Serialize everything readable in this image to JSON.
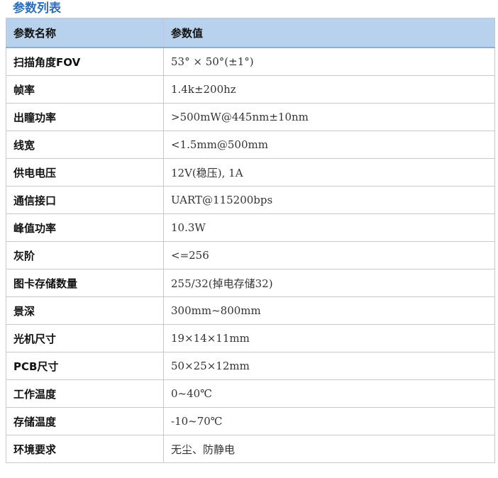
{
  "section_title": "参数列表",
  "table": {
    "headers": [
      "参数名称",
      "参数值"
    ],
    "rows": [
      {
        "name": "扫描角度FOV",
        "value": "53° × 50°(±1°)"
      },
      {
        "name": "帧率",
        "value": "1.4k±200hz"
      },
      {
        "name": "出瞳功率",
        "value": ">500mW@445nm±10nm"
      },
      {
        "name": "线宽",
        "value": "<1.5mm@500mm"
      },
      {
        "name": "供电电压",
        "value": "12V(稳压), 1A"
      },
      {
        "name": "通信接口",
        "value": "UART@115200bps"
      },
      {
        "name": "峰值功率",
        "value": "10.3W"
      },
      {
        "name": "灰阶",
        "value": "<=256"
      },
      {
        "name": "图卡存储数量",
        "value": "255/32(掉电存储32)"
      },
      {
        "name": "景深",
        "value": "300mm~800mm"
      },
      {
        "name": "光机尺寸",
        "value": "19×14×11mm"
      },
      {
        "name": "PCB尺寸",
        "value": "50×25×12mm"
      },
      {
        "name": "工作温度",
        "value": "0~40℃"
      },
      {
        "name": "存储温度",
        "value": "-10~70℃"
      },
      {
        "name": "环境要求",
        "value": "无尘、防静电"
      }
    ]
  },
  "colors": {
    "title": "#2f6fb5",
    "header_bg": "#b8d1ec",
    "border": "#c7c7c7"
  }
}
